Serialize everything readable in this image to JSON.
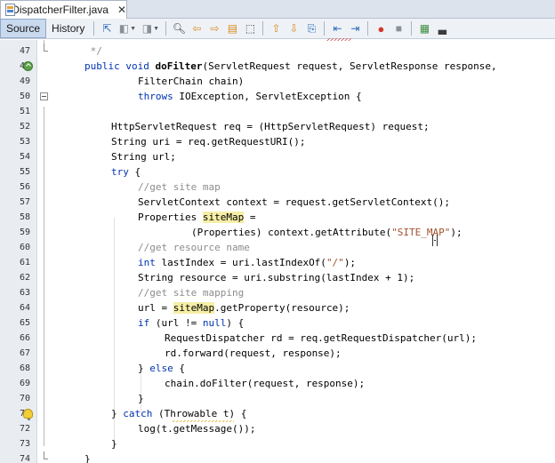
{
  "tab": {
    "title": "DispatcherFilter.java",
    "close": "✕"
  },
  "toolbar": {
    "source_label": "Source",
    "history_label": "History"
  },
  "colors": {
    "keyword": "#0033b3",
    "comment": "#8c8c8c",
    "string": "#a0522d",
    "highlight": "#f5eea6",
    "gutter": "#e9ecf1"
  },
  "icons": {
    "gutter_override": "override-arrow-icon",
    "gutter_hint": "lightbulb-hint-icon"
  },
  "lines": [
    {
      "n": "47",
      "text": " */"
    },
    {
      "n": "48",
      "text": "public void doFilter(ServletRequest request, ServletResponse response,"
    },
    {
      "n": "49",
      "text": "        FilterChain chain)"
    },
    {
      "n": "50",
      "text": "        throws IOException, ServletException {"
    },
    {
      "n": "51",
      "text": ""
    },
    {
      "n": "52",
      "text": "    HttpServletRequest req = (HttpServletRequest) request;"
    },
    {
      "n": "53",
      "text": "    String uri = req.getRequestURI();"
    },
    {
      "n": "54",
      "text": "    String url;"
    },
    {
      "n": "55",
      "text": "    try {"
    },
    {
      "n": "56",
      "text": "        //get site map"
    },
    {
      "n": "57",
      "text": "        ServletContext context = request.getServletContext();"
    },
    {
      "n": "58",
      "text": "        Properties siteMap ="
    },
    {
      "n": "59",
      "text": "                (Properties) context.getAttribute(\"SITE_MAP\");"
    },
    {
      "n": "60",
      "text": "        //get resource name"
    },
    {
      "n": "61",
      "text": "        int lastIndex = uri.lastIndexOf(\"/\");"
    },
    {
      "n": "62",
      "text": "        String resource = uri.substring(lastIndex + 1);"
    },
    {
      "n": "63",
      "text": "        //get site mapping"
    },
    {
      "n": "64",
      "text": "        url = siteMap.getProperty(resource);"
    },
    {
      "n": "65",
      "text": "        if (url != null) {"
    },
    {
      "n": "66",
      "text": "            RequestDispatcher rd = req.getRequestDispatcher(url);"
    },
    {
      "n": "67",
      "text": "            rd.forward(request, response);"
    },
    {
      "n": "68",
      "text": "        } else {"
    },
    {
      "n": "69",
      "text": "            chain.doFilter(request, response);"
    },
    {
      "n": "70",
      "text": "        }"
    },
    {
      "n": "71",
      "text": "    } catch (Throwable t) {"
    },
    {
      "n": "72",
      "text": "        log(t.getMessage());"
    },
    {
      "n": "73",
      "text": "    }"
    },
    {
      "n": "74",
      "text": "}"
    }
  ]
}
